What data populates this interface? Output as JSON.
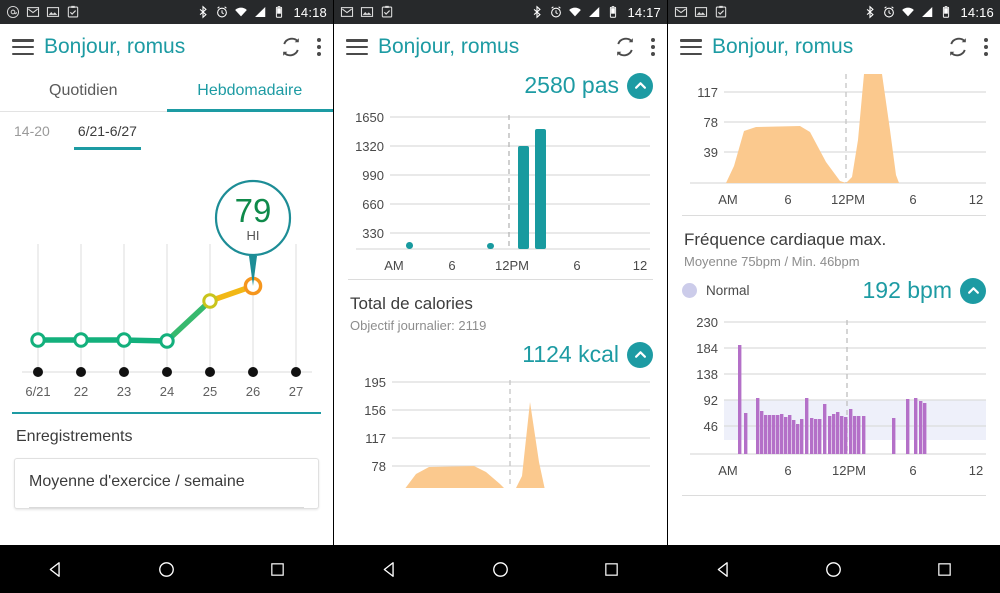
{
  "theme": {
    "teal": "#1d9ba3",
    "green": "#13b07c",
    "orange": "#f5a623",
    "peach": "#fbc98e",
    "purple": "#b470c8",
    "lavender": "#ccccea",
    "grid": "#dcdcdc",
    "text_dark": "#3c3c3c",
    "text_muted": "#8d8d8d"
  },
  "panels": [
    {
      "status": {
        "time": "14:18",
        "left_icons": [
          "at-sign-icon",
          "mail-icon",
          "image-icon",
          "clipboard-check-icon"
        ],
        "right_icons": [
          "bluetooth-icon",
          "alarm-icon",
          "wifi-icon",
          "signal-icon",
          "battery-icon"
        ]
      },
      "appbar": {
        "title": "Bonjour, romus",
        "menu_icon": "hamburger-icon",
        "refresh_icon": "refresh-icon",
        "overflow_icon": "kebab-menu-icon"
      },
      "tabs": [
        {
          "label": "Quotidien",
          "active": false
        },
        {
          "label": "Hebdomadaire",
          "active": true
        }
      ],
      "weeks": [
        {
          "label": "14-20",
          "active": false
        },
        {
          "label": "6/21-6/27",
          "active": true
        }
      ],
      "bubble": {
        "value": "79",
        "unit": "HI"
      },
      "records_title": "Enregistrements",
      "record_card_label": "Moyenne d'exercice / semaine"
    },
    {
      "status": {
        "time": "14:17",
        "left_icons": [
          "mail-icon",
          "image-icon",
          "clipboard-check-icon"
        ],
        "right_icons": [
          "bluetooth-icon",
          "alarm-icon",
          "wifi-icon",
          "signal-icon",
          "battery-icon"
        ]
      },
      "appbar": {
        "title": "Bonjour, romus",
        "menu_icon": "hamburger-icon",
        "refresh_icon": "refresh-icon",
        "overflow_icon": "kebab-menu-icon"
      },
      "steps_metric": "2580 pas",
      "calories_title": "Total de calories",
      "calories_goal": "Objectif journalier: 2119",
      "calories_metric": "1124 kcal"
    },
    {
      "status": {
        "time": "14:16",
        "left_icons": [
          "mail-icon",
          "image-icon",
          "clipboard-check-icon"
        ],
        "right_icons": [
          "bluetooth-icon",
          "alarm-icon",
          "wifi-icon",
          "signal-icon",
          "battery-icon"
        ]
      },
      "appbar": {
        "title": "Bonjour, romus",
        "menu_icon": "hamburger-icon",
        "refresh_icon": "refresh-icon",
        "overflow_icon": "kebab-menu-icon"
      },
      "hr_title": "Fréquence cardiaque max.",
      "hr_sub": "Moyenne 75bpm / Min. 46bpm",
      "hr_legend": "Normal",
      "hr_metric": "192 bpm"
    }
  ],
  "chart_data": [
    {
      "id": "weekly-score",
      "type": "line",
      "title": "",
      "categories": [
        "6/21",
        "22",
        "23",
        "24",
        "25",
        "26",
        "27"
      ],
      "values": [
        42,
        42,
        42,
        41,
        62,
        72,
        null
      ],
      "annotation": {
        "label": "79",
        "sublabel": "HI",
        "at_category": "26"
      },
      "segment_colors": [
        "#13b07c",
        "#13b07c",
        "#13b07c",
        "#5cc267",
        "#e8c227",
        "#f5a623"
      ],
      "grid": true,
      "xlabel": "",
      "ylabel": "",
      "ylim": [
        0,
        100
      ]
    },
    {
      "id": "steps",
      "type": "bar",
      "title": "",
      "ylabel": "",
      "xlabel": "",
      "yticks": [
        330,
        660,
        990,
        1320,
        1650
      ],
      "ylim": [
        0,
        1760
      ],
      "xticks": [
        "AM",
        "6",
        "12PM",
        "6",
        "12"
      ],
      "marker_line_at": "12PM",
      "bars": [
        {
          "x": 2.6,
          "value": 70,
          "width": 0.22
        },
        {
          "x": 10.3,
          "value": 60,
          "width": 0.22
        },
        {
          "x": 12.8,
          "value": 1170,
          "width": 0.4
        },
        {
          "x": 13.6,
          "value": 1370,
          "width": 0.4
        }
      ],
      "color": "#1d9ba3",
      "grid": true
    },
    {
      "id": "calories",
      "type": "area",
      "title": "Total de calories",
      "yticks": [
        39,
        78,
        117,
        156,
        195
      ],
      "ylim": [
        0,
        215
      ],
      "xticks": [
        "AM",
        "6",
        "12PM",
        "6",
        "12"
      ],
      "marker_line_at": "12PM",
      "points": [
        [
          2.2,
          0
        ],
        [
          3.0,
          60
        ],
        [
          4.0,
          73
        ],
        [
          7.0,
          74
        ],
        [
          8.2,
          72
        ],
        [
          9.0,
          55
        ],
        [
          10.2,
          18
        ],
        [
          10.9,
          0
        ],
        [
          11.6,
          0
        ],
        [
          12.2,
          70
        ],
        [
          13.0,
          172
        ],
        [
          13.8,
          60
        ],
        [
          14.1,
          0
        ]
      ],
      "color": "#fbc98e",
      "grid": true
    },
    {
      "id": "calories-top",
      "type": "area",
      "title": "",
      "yticks": [
        39,
        78,
        117
      ],
      "ylim": [
        0,
        135
      ],
      "xticks": [
        "AM",
        "6",
        "12PM",
        "6",
        "12"
      ],
      "marker_line_at": "12PM",
      "points": [
        [
          2.2,
          0
        ],
        [
          3.0,
          60
        ],
        [
          4.0,
          71
        ],
        [
          7.0,
          72
        ],
        [
          8.2,
          70
        ],
        [
          9.0,
          52
        ],
        [
          10.3,
          16
        ],
        [
          11.0,
          0
        ],
        [
          11.6,
          2
        ],
        [
          12.1,
          80
        ],
        [
          12.5,
          130
        ],
        [
          13.4,
          130
        ],
        [
          13.9,
          40
        ],
        [
          14.1,
          0
        ]
      ],
      "color": "#fbc98e",
      "grid": true
    },
    {
      "id": "heart-rate",
      "type": "bar",
      "title": "Fréquence cardiaque max.",
      "subtitle": "Moyenne 75bpm / Min. 46bpm",
      "legend": [
        {
          "name": "Normal",
          "color": "#ccccea"
        }
      ],
      "yticks": [
        46,
        92,
        138,
        184,
        230
      ],
      "ylim": [
        0,
        250
      ],
      "xticks": [
        "AM",
        "6",
        "12PM",
        "6",
        "12"
      ],
      "marker_line_at": "12PM",
      "normal_band": [
        46,
        100
      ],
      "color": "#b470c8",
      "values": [
        [
          2.55,
          190
        ],
        [
          2.75,
          72
        ],
        [
          3.4,
          100
        ],
        [
          3.65,
          75
        ],
        [
          3.9,
          68
        ],
        [
          4.1,
          68
        ],
        [
          4.3,
          68
        ],
        [
          4.5,
          68
        ],
        [
          4.7,
          70
        ],
        [
          4.9,
          66
        ],
        [
          5.1,
          68
        ],
        [
          5.3,
          60
        ],
        [
          5.5,
          55
        ],
        [
          5.7,
          62
        ],
        [
          5.95,
          100
        ],
        [
          6.2,
          64
        ],
        [
          6.4,
          63
        ],
        [
          6.6,
          63
        ],
        [
          6.85,
          88
        ],
        [
          7.1,
          66
        ],
        [
          7.3,
          70
        ],
        [
          7.5,
          72
        ],
        [
          7.7,
          66
        ],
        [
          7.9,
          64
        ],
        [
          8.1,
          78
        ],
        [
          8.3,
          66
        ],
        [
          8.5,
          67
        ],
        [
          8.75,
          67
        ],
        [
          11.4,
          62
        ],
        [
          11.95,
          98
        ],
        [
          12.25,
          100
        ],
        [
          12.45,
          95
        ],
        [
          12.6,
          92
        ]
      ],
      "grid": true
    }
  ],
  "navbar": {
    "back_icon": "back-triangle-icon",
    "home_icon": "home-circle-icon",
    "recents_icon": "recents-square-icon"
  }
}
